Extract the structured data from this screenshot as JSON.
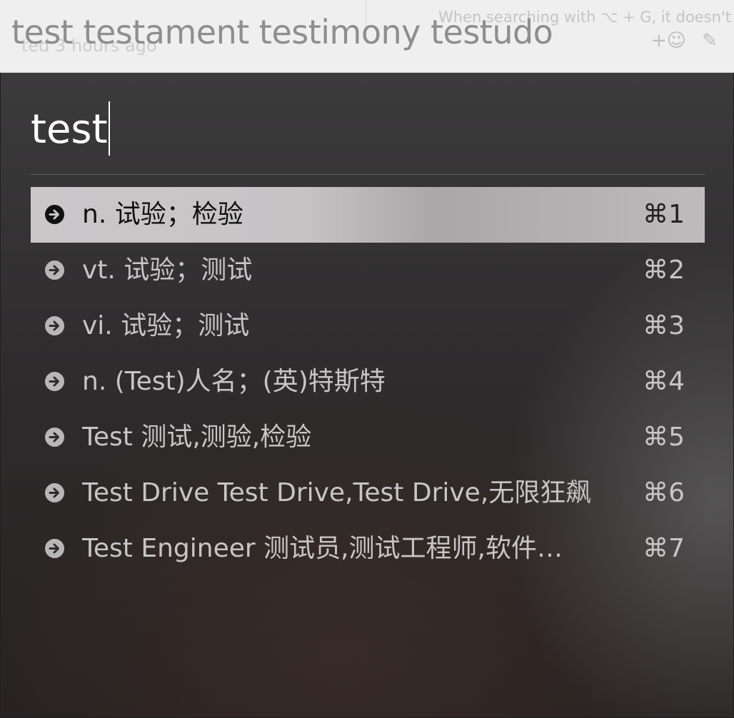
{
  "background": {
    "comment_text": "When searching with ⌥ + G, it doesn't",
    "time_text": "ted 3 hours ago",
    "icons": [
      "add-reaction-icon",
      "edit-icon"
    ]
  },
  "completion": {
    "text": "test testament testimony testudo"
  },
  "search": {
    "query": "test"
  },
  "results": [
    {
      "label": "n. 试验；检验",
      "shortcut": "⌘1",
      "selected": true
    },
    {
      "label": "vt. 试验；测试",
      "shortcut": "⌘2",
      "selected": false
    },
    {
      "label": "vi. 试验；测试",
      "shortcut": "⌘3",
      "selected": false
    },
    {
      "label": "n. (Test)人名；(英)特斯特",
      "shortcut": "⌘4",
      "selected": false
    },
    {
      "label": "Test 测试,测验,检验",
      "shortcut": "⌘5",
      "selected": false
    },
    {
      "label": "Test Drive Test Drive,Test Drive,无限狂飙",
      "shortcut": "⌘6",
      "selected": false
    },
    {
      "label": "Test Engineer 测试员,测试工程师,软件…",
      "shortcut": "⌘7",
      "selected": false
    }
  ],
  "colors": {
    "panel": "#2e2c2d",
    "selected_row": "#c6c4c5",
    "text": "#c7c5c6",
    "query": "#ffffff"
  }
}
